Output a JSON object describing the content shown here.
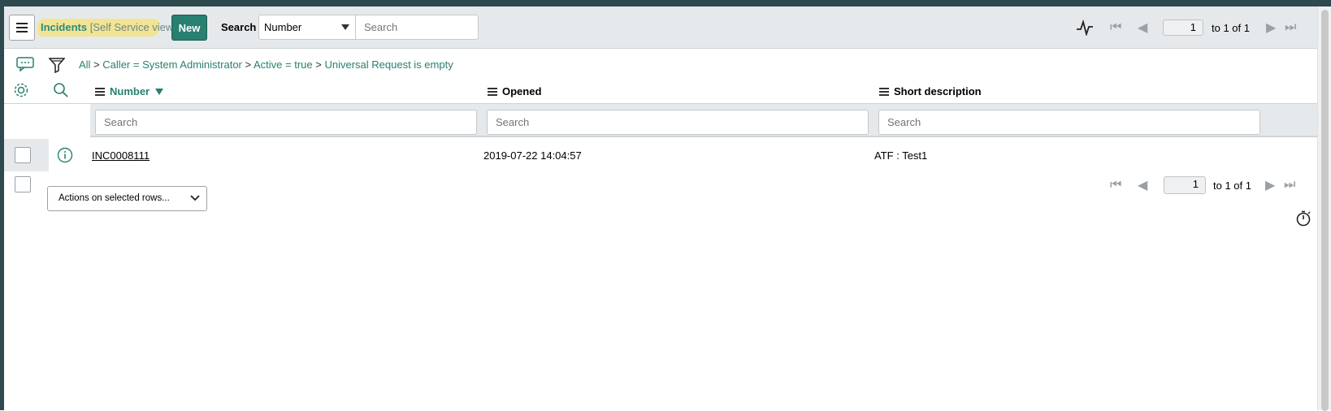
{
  "header": {
    "list_title": "Incidents",
    "view_label": "[Self Service view]",
    "new_button": "New",
    "search_label": "Search",
    "search_field_select": "Number",
    "search_placeholder": "Search",
    "page_value": "1",
    "page_range": "to 1 of 1"
  },
  "breadcrumb": {
    "all": "All",
    "sep": ">",
    "filters": [
      "Caller = System Administrator",
      "Active = true",
      "Universal Request is empty"
    ]
  },
  "columns": [
    {
      "label": "Number",
      "sorted": "descending",
      "search_placeholder": "Search"
    },
    {
      "label": "Opened",
      "search_placeholder": "Search"
    },
    {
      "label": "Short description",
      "search_placeholder": "Search"
    }
  ],
  "rows": [
    {
      "number": "INC0008111",
      "opened": "2019-07-22 14:04:57",
      "short_description": "ATF : Test1"
    }
  ],
  "footer": {
    "actions_select": "Actions on selected rows...",
    "page_value": "1",
    "page_range": "to 1 of 1"
  },
  "colors": {
    "accent": "#278070",
    "header_bg": "#e6e9eb",
    "highlight": "#f5e178"
  }
}
